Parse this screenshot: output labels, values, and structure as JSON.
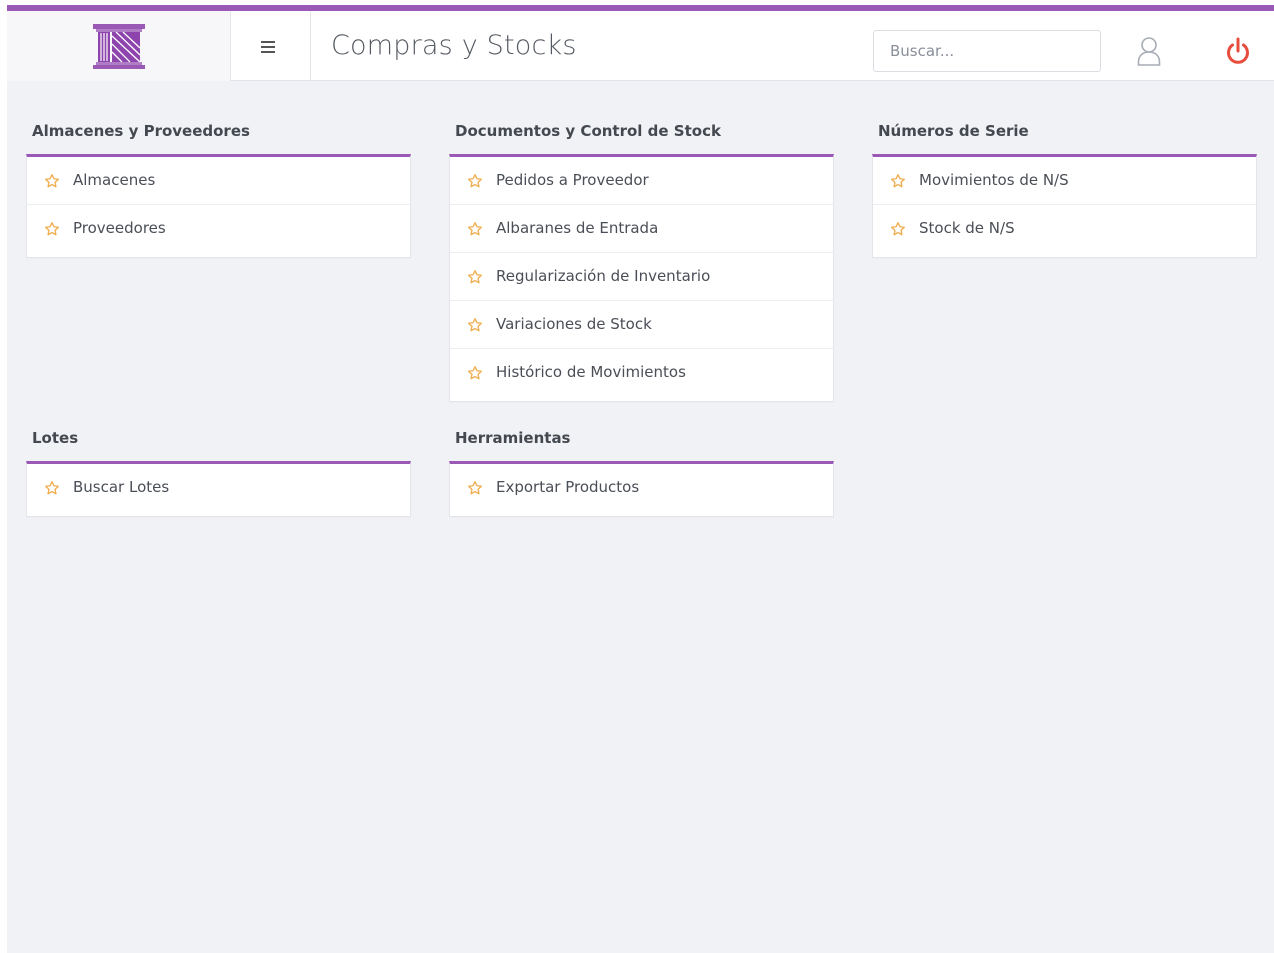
{
  "header": {
    "title": "Compras y Stocks",
    "search_placeholder": "Buscar..."
  },
  "colors": {
    "accent": "#9b59b6",
    "star": "#f0ad4e",
    "power": "#e74c3c"
  },
  "sections": [
    {
      "title": "Almacenes y Proveedores",
      "items": [
        "Almacenes",
        "Proveedores"
      ]
    },
    {
      "title": "Documentos y Control de Stock",
      "items": [
        "Pedidos a Proveedor",
        "Albaranes de Entrada",
        "Regularización de Inventario",
        "Variaciones de Stock",
        "Histórico de Movimientos"
      ]
    },
    {
      "title": "Números de Serie",
      "items": [
        "Movimientos de N/S",
        "Stock de N/S"
      ]
    },
    {
      "title": "Lotes",
      "items": [
        "Buscar Lotes"
      ]
    },
    {
      "title": "Herramientas",
      "items": [
        "Exportar Productos"
      ]
    }
  ]
}
